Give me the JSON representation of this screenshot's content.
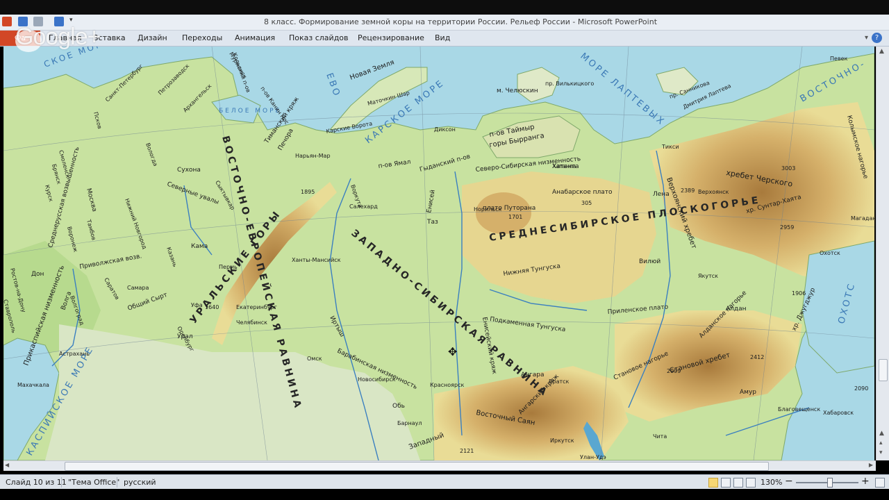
{
  "window": {
    "title": "8 класс. Формирование земной коры на территории России. Рельеф России  -  Microsoft PowerPoint"
  },
  "ribbon": {
    "file_tab": "Фа",
    "tabs": [
      "Главная",
      "Вставка",
      "Дизайн",
      "Переходы",
      "Анимация",
      "Показ слайдов",
      "Рецензирование",
      "Вид"
    ]
  },
  "overlay": {
    "logo_text": "Google+"
  },
  "map": {
    "seas": {
      "kara": "КАРСКОЕ МОРЕ",
      "laptev": "МОРЕ ЛАПТЕВЫХ",
      "east_siberian": "ВОСТОЧНО-",
      "okhotsk": "ОХОТС",
      "caspian": "КАСПИЙСКОЕ МОРЕ",
      "barents": "ЕВО",
      "white": "БЕЛОЕ МОРЕ",
      "barents_left": "СКОЕ МОРЕ"
    },
    "regions": {
      "east_european": "ВОСТОЧНО-ЕВРОПЕЙСКАЯ РАВНИНА",
      "west_siberian": "ЗАПАДНО-СИБИРСКАЯ РАВНИНА",
      "central_siberian": "СРЕДНЕСИБИРСКОЕ ПЛОСКОГОРЬЕ",
      "ural": "УРАЛЬСКИЕ ГОРЫ"
    },
    "features": {
      "novaya_zemlya": "Новая Земля",
      "taimyr": "п-ов Таймыр",
      "byrranga": "горы Бырранга",
      "chelyuskin": "м. Челюскин",
      "north_siberian": "Северо-Сибирская низменность",
      "anabar": "Анабарское плато",
      "putorana": "плато Путорана",
      "verkhoyansk": "Верхоянский хребет",
      "chersky": "хребет Черского",
      "suntar": "хр. Сунтар-Хаята",
      "kolyma": "Колымское нагорье",
      "prilenskoe": "Приленское плато",
      "aldan": "Алданское нагорье",
      "stanovoy_range": "Становой хребет",
      "stanovoy_upland": "Становое нагорье",
      "dzhugdzhur": "хр. Джугджур",
      "east_sayan": "Восточный Саян",
      "west": "Западный",
      "angara": "Ангарский кряж",
      "enisey_ridge": "Енисейский кряж",
      "baraba": "Барабинская низменность",
      "caspian_low": "Прикаспийская низменность",
      "timan": "Тиманский кряж",
      "north_uvaly": "Северные увалы",
      "sredne_russ": "Среднерусская возвышенность",
      "privolzh": "Приволжская возв.",
      "obshchiy_syrt": "Общий Сырт",
      "yamal": "п-ов Ямал",
      "gydan": "Гыданский п-ов",
      "kanin": "п-ов Канин Нос",
      "kolsky": "Кольский п-ов"
    },
    "rivers": [
      "Обь",
      "Енисей",
      "Лена",
      "Иртыш",
      "Вилюй",
      "Алдан",
      "Ангара",
      "Волга",
      "Дон",
      "Печора",
      "Кама",
      "Нижняя Тунгуска",
      "Подкаменная Тунгуска",
      "Амур",
      "Хатанга",
      "Сухона",
      "Урал",
      "Таз"
    ],
    "cities": [
      "Москва",
      "Санкт-Петербург",
      "Смоленск",
      "Брянск",
      "Курск",
      "Воронеж",
      "Тамбов",
      "Самара",
      "Саратов",
      "Волгоград",
      "Астрахань",
      "Ростов-на-Дону",
      "Ставрополь",
      "Махачкала",
      "Казань",
      "Пермь",
      "Уфа",
      "Оренбург",
      "Екатеринбург",
      "Челябинск",
      "Омск",
      "Новосибирск",
      "Барнаул",
      "Красноярск",
      "Братск",
      "Иркутск",
      "Улан-Удэ",
      "Чита",
      "Тикси",
      "Якутск",
      "Хатанга",
      "Диксон",
      "Норильск",
      "Салехард",
      "Воркута",
      "Нарьян-Мар",
      "Ханты-Мансийск",
      "Вологда",
      "Архангельск",
      "Мурманск",
      "Петрозаводск",
      "Псков",
      "Нижний Новгород",
      "Сыктывкар",
      "Благовещенск",
      "Хабаровск",
      "Охотск",
      "Магадан",
      "Верхоянск",
      "Певек"
    ],
    "heights": [
      "1701",
      "305",
      "1895",
      "3003",
      "2959",
      "2389",
      "1906",
      "2412",
      "2999",
      "2090",
      "1640",
      "2121"
    ],
    "straits": [
      "пр. Вилькицкого",
      "Карские Ворота",
      "Маточкин Шар",
      "пр. Санникова",
      "Дмитрия Лаптева"
    ]
  },
  "statusbar": {
    "slide": "Слайд 10 из 11",
    "theme": "\"Тема Office\"",
    "language": "русский",
    "zoom": "130%",
    "zoom_minus": "−",
    "zoom_plus": "+"
  },
  "colors": {
    "ppt_orange": "#d24726",
    "sea": "#a9d8e6",
    "lowland": "#c8e2a0",
    "upland": "#e6d690",
    "mountain": "#c79a55"
  }
}
